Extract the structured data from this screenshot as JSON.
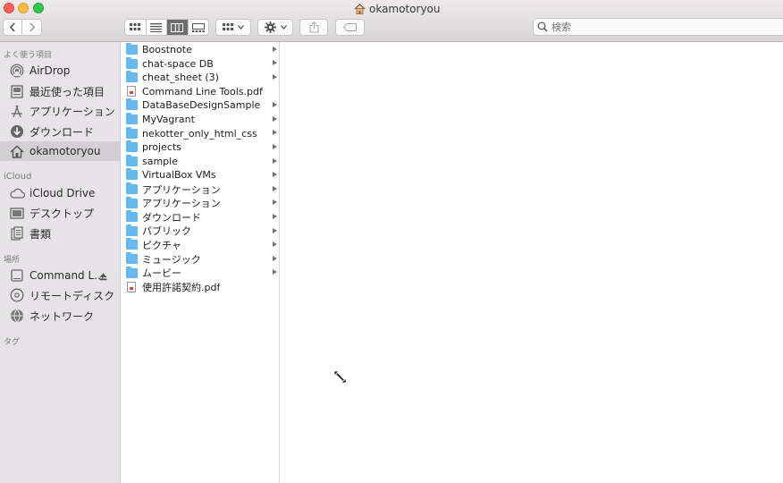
{
  "window": {
    "title": "okamotoryou"
  },
  "toolbar": {
    "back_icon": "chevron-left-icon",
    "forward_icon": "chevron-right-icon",
    "view_modes": [
      "icon-view",
      "list-view",
      "column-view",
      "gallery-view"
    ],
    "selected_view": "column-view",
    "search_placeholder": "検索"
  },
  "sidebar": {
    "favorites_header": "よく使う項目",
    "favorites": [
      {
        "label": "AirDrop",
        "icon": "airdrop-icon"
      },
      {
        "label": "最近使った項目",
        "icon": "recents-icon"
      },
      {
        "label": "アプリケーション",
        "icon": "applications-icon"
      },
      {
        "label": "ダウンロード",
        "icon": "downloads-icon"
      },
      {
        "label": "okamotoryou",
        "icon": "home-icon",
        "selected": true
      }
    ],
    "icloud_header": "iCloud",
    "icloud": [
      {
        "label": "iCloud Drive",
        "icon": "cloud-icon"
      },
      {
        "label": "デスクトップ",
        "icon": "desktop-icon"
      },
      {
        "label": "書類",
        "icon": "documents-icon"
      }
    ],
    "locations_header": "場所",
    "locations": [
      {
        "label": "Command L...",
        "icon": "disk-icon"
      },
      {
        "label": "リモートディスク",
        "icon": "remote-disc-icon"
      },
      {
        "label": "ネットワーク",
        "icon": "network-icon"
      }
    ],
    "tags_header": "タグ"
  },
  "column": {
    "items": [
      {
        "name": "Boostnote",
        "kind": "folder"
      },
      {
        "name": "chat-space  DB",
        "kind": "folder"
      },
      {
        "name": "cheat_sheet (3)",
        "kind": "folder"
      },
      {
        "name": "Command Line Tools.pdf",
        "kind": "file"
      },
      {
        "name": "DataBaseDesignSample",
        "kind": "folder"
      },
      {
        "name": "MyVagrant",
        "kind": "folder"
      },
      {
        "name": "nekotter_only_html_css",
        "kind": "folder"
      },
      {
        "name": "projects",
        "kind": "folder"
      },
      {
        "name": "sample",
        "kind": "folder"
      },
      {
        "name": "VirtualBox VMs",
        "kind": "folder"
      },
      {
        "name": "アプリケーション",
        "kind": "folder"
      },
      {
        "name": "アプリケーション",
        "kind": "folder"
      },
      {
        "name": "ダウンロード",
        "kind": "folder"
      },
      {
        "name": "パブリック",
        "kind": "folder"
      },
      {
        "name": "ピクチャ",
        "kind": "folder"
      },
      {
        "name": "ミュージック",
        "kind": "folder"
      },
      {
        "name": "ムービー",
        "kind": "folder"
      },
      {
        "name": "使用許諾契約.pdf",
        "kind": "file"
      }
    ]
  }
}
